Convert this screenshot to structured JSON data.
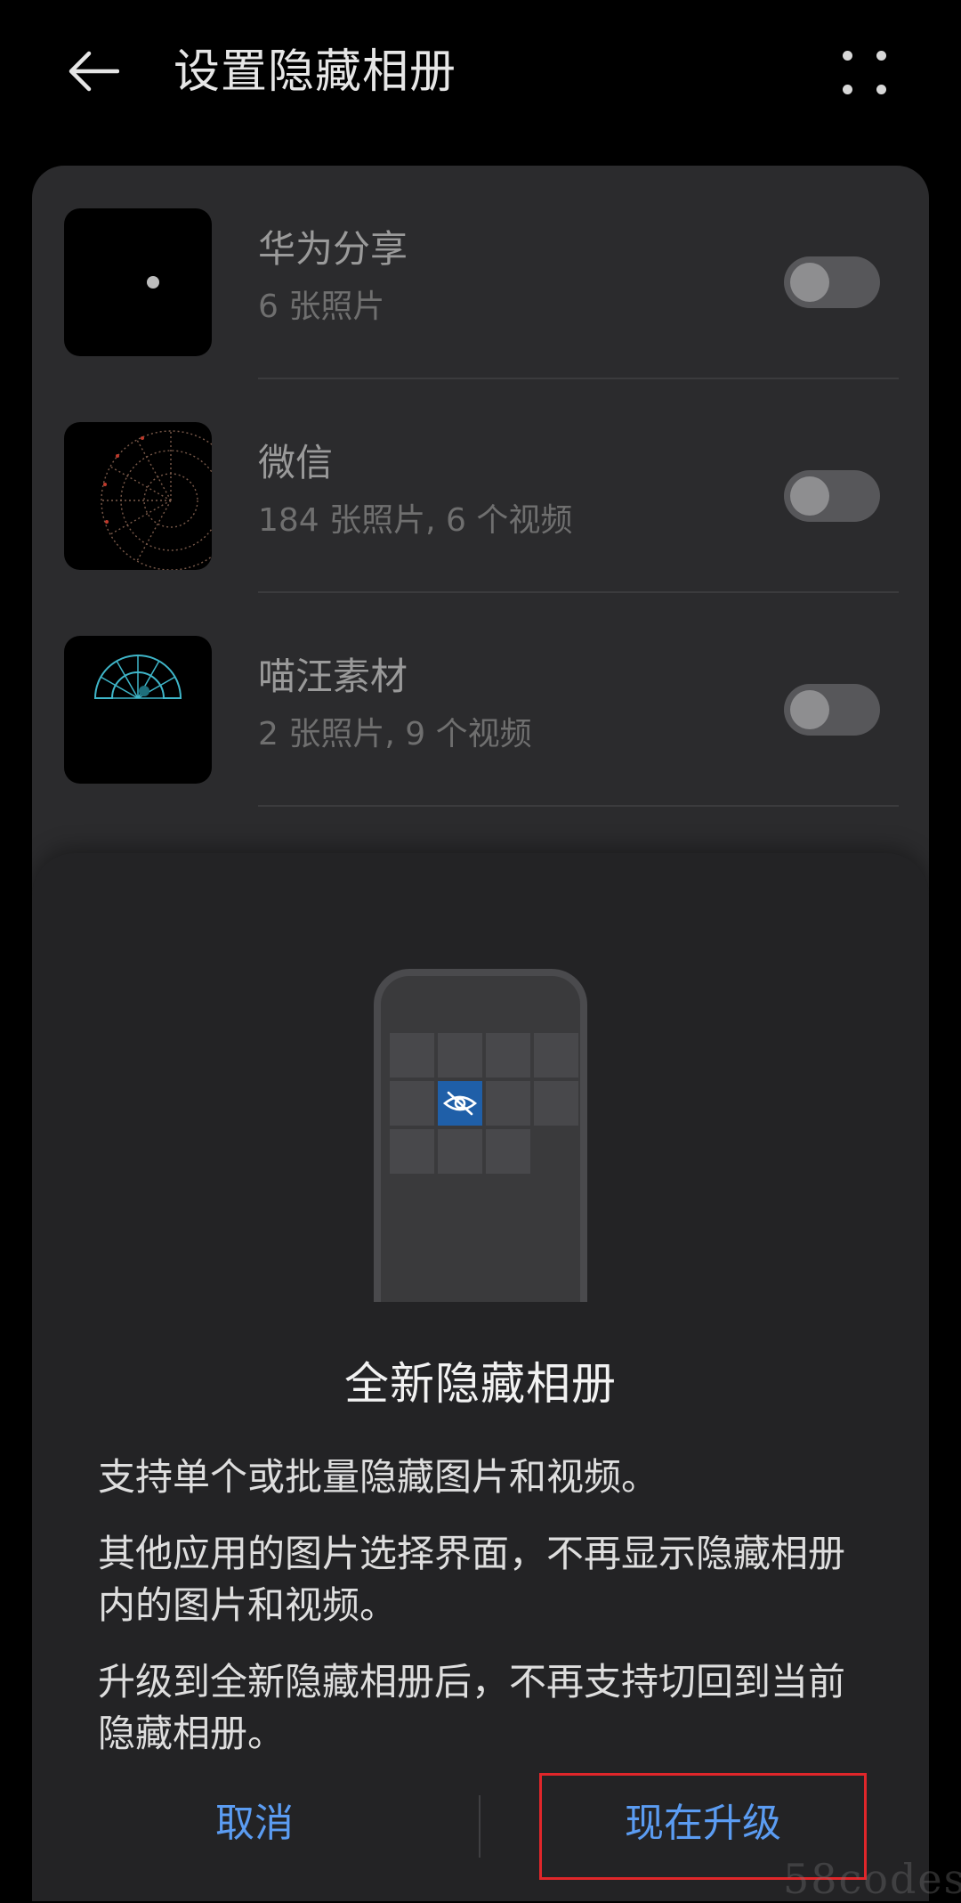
{
  "header": {
    "title": "设置隐藏相册"
  },
  "albums": [
    {
      "name": "华为分享",
      "count": "6 张照片",
      "toggle_on": false
    },
    {
      "name": "微信",
      "count": "184 张照片, 6 个视频",
      "toggle_on": false
    },
    {
      "name": "喵汪素材",
      "count": "2 张照片, 9 个视频",
      "toggle_on": false
    }
  ],
  "sheet": {
    "title": "全新隐藏相册",
    "paragraphs": [
      "支持单个或批量隐藏图片和视频。",
      "其他应用的图片选择界面，不再显示隐藏相册内的图片和视频。",
      "升级到全新隐藏相册后，不再支持切回到当前隐藏相册。"
    ],
    "cancel_label": "取消",
    "upgrade_label": "现在升级"
  },
  "watermark": "58codes",
  "colors": {
    "background": "#000000",
    "card": "#2b2b2d",
    "sheet": "#232325",
    "accent": "#5b9cf2",
    "hidden_tile": "#1f5fa8",
    "highlight_box": "#e0262a"
  }
}
